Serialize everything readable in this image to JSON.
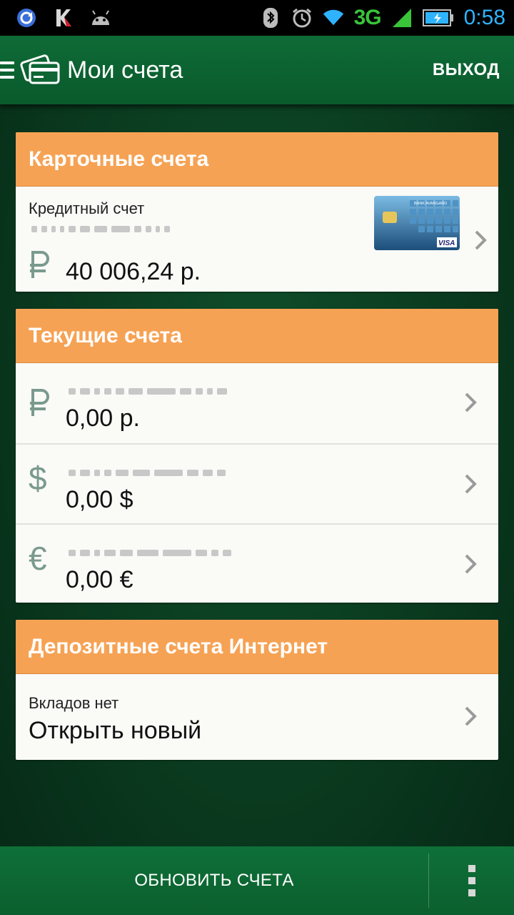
{
  "status_bar": {
    "network": "3G",
    "time": "0:58",
    "icons": [
      "sync-icon",
      "kaspersky-icon",
      "android-icon",
      "bluetooth-icon",
      "alarm-icon",
      "wifi-icon",
      "signal-icon",
      "battery-icon"
    ]
  },
  "header": {
    "title": "Мои счета",
    "exit_label": "ВЫХОД"
  },
  "card_accounts": {
    "title": "Карточные счета",
    "items": [
      {
        "name": "Кредитный счет",
        "currency_icon": "ruble-icon",
        "amount": "40 006,24 р."
      }
    ]
  },
  "current_accounts": {
    "title": "Текущие счета",
    "items": [
      {
        "currency_icon": "ruble-icon",
        "amount": "0,00 р."
      },
      {
        "currency_icon": "dollar-icon",
        "symbol": "$",
        "amount": "0,00 $"
      },
      {
        "currency_icon": "euro-icon",
        "symbol": "€",
        "amount": "0,00 €"
      }
    ]
  },
  "deposit_accounts": {
    "title": "Депозитные счета Интернет",
    "empty_label": "Вкладов нет",
    "action_label": "Открыть новый"
  },
  "bottom_bar": {
    "refresh_label": "ОБНОВИТЬ СЧЕТА"
  },
  "colors": {
    "section_header": "#f6a254",
    "action_bar": "#0e6b36",
    "background": "#0a3a1f",
    "network_3g": "#39c43a",
    "clock": "#2fb3ff"
  },
  "card_image": {
    "bank_text": "BANK AVANGARD",
    "brand": "VISA"
  }
}
